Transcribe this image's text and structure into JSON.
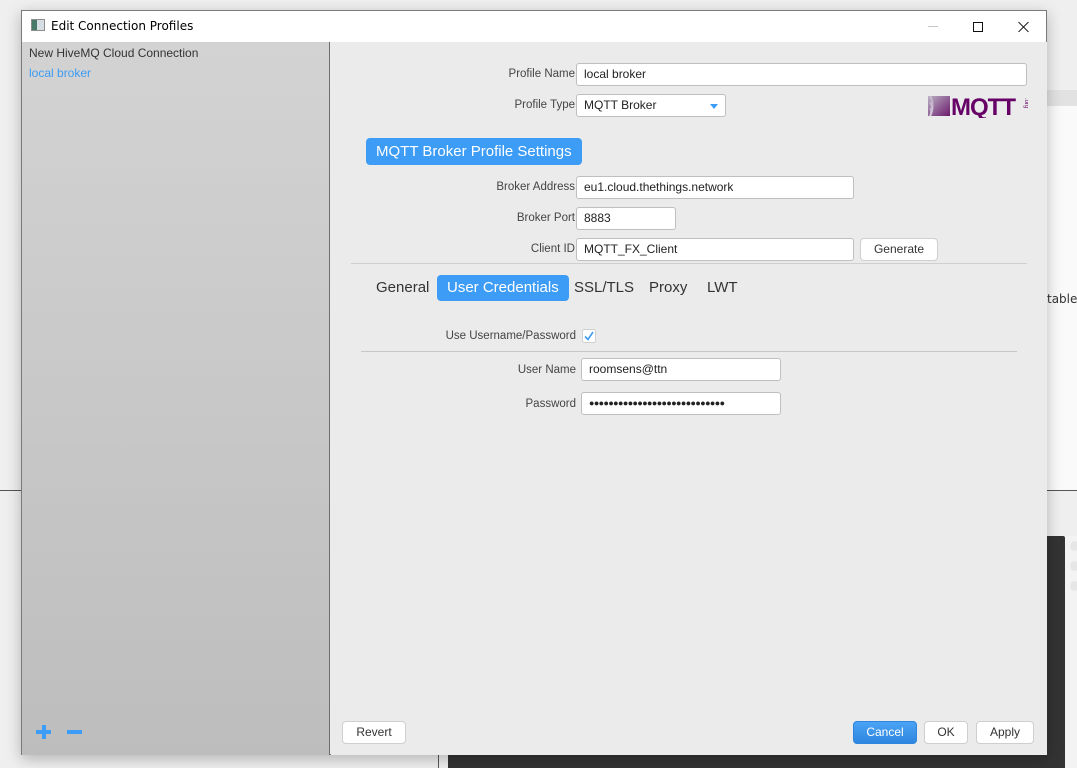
{
  "window": {
    "title": "Edit Connection Profiles",
    "controls": {
      "minimize": "minimize",
      "maximize": "maximize",
      "close": "close"
    }
  },
  "sidebar": {
    "profiles": [
      {
        "label": "New HiveMQ Cloud Connection",
        "selected": false
      },
      {
        "label": "local broker",
        "selected": true
      }
    ],
    "add_icon": "plus-icon",
    "remove_icon": "minus-icon"
  },
  "profile": {
    "name_label": "Profile Name",
    "name_value": "local broker",
    "type_label": "Profile Type",
    "type_value": "MQTT Broker",
    "logo_text": "MQTT",
    "logo_suffix": ".org"
  },
  "broker_settings": {
    "section_title": "MQTT Broker Profile Settings",
    "address_label": "Broker Address",
    "address_value": "eu1.cloud.thethings.network",
    "port_label": "Broker Port",
    "port_value": "8883",
    "client_id_label": "Client ID",
    "client_id_value": "MQTT_FX_Client",
    "generate_label": "Generate"
  },
  "tabs": [
    {
      "label": "General",
      "active": false
    },
    {
      "label": "User Credentials",
      "active": true
    },
    {
      "label": "SSL/TLS",
      "active": false
    },
    {
      "label": "Proxy",
      "active": false
    },
    {
      "label": "LWT",
      "active": false
    }
  ],
  "credentials": {
    "use_label": "Use Username/Password",
    "use_checked": true,
    "username_label": "User Name",
    "username_value": "roomsens@ttn",
    "password_label": "Password",
    "password_value": "●●●●●●●●●●●●●●●●●●●●●●●●●●●●"
  },
  "footer": {
    "revert_label": "Revert",
    "cancel_label": "Cancel",
    "ok_label": "OK",
    "apply_label": "Apply"
  },
  "background": {
    "partial_text": "table"
  },
  "colors": {
    "accent": "#3d9cf5",
    "mqtt_logo": "#660066"
  }
}
